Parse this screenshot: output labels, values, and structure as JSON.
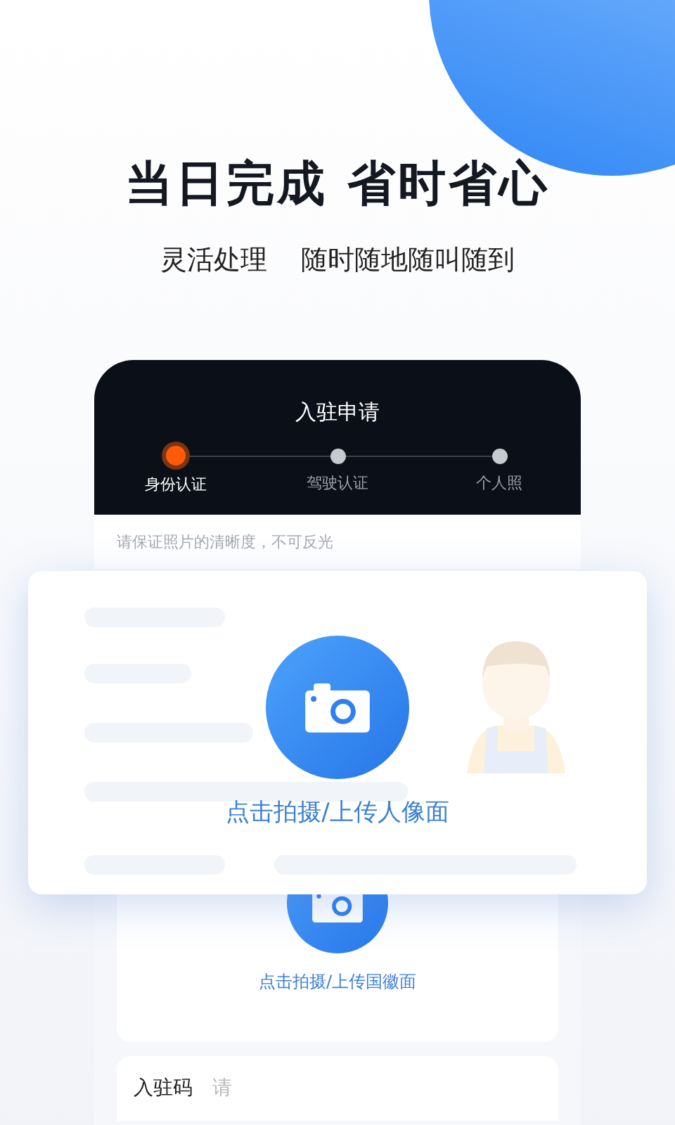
{
  "headline": "当日完成 省时省心",
  "subtitle": [
    "灵活处理",
    "随时随地随叫随到"
  ],
  "phone": {
    "title": "入驻申请",
    "steps": [
      {
        "label": "身份认证",
        "selected": true
      },
      {
        "label": "驾驶认证",
        "selected": false
      },
      {
        "label": "个人照",
        "selected": false
      }
    ],
    "hint": "请保证照片的清晰度，不可反光",
    "back_upload": {
      "label": "点击拍摄/上传国徽面"
    },
    "code_field": {
      "label": "入驻码",
      "placeholder": "请"
    }
  },
  "front_upload": {
    "label": "点击拍摄/上传人像面"
  }
}
